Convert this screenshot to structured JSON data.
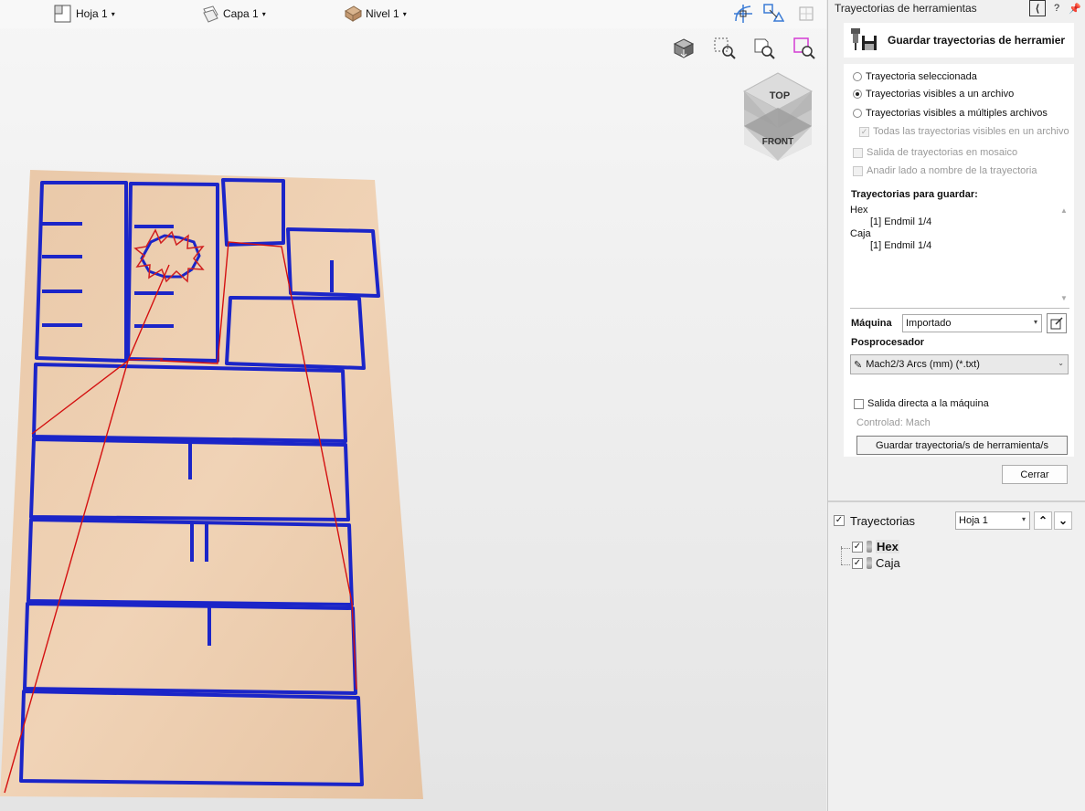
{
  "toolbar": {
    "sheet": "Hoja 1",
    "layer": "Capa 1",
    "level": "Nivel 1"
  },
  "view_cube": {
    "top": "TOP",
    "front": "FRONT"
  },
  "panel": {
    "title": "Trayectorias de herramientas",
    "help": "?",
    "header": "Guardar trayectorias de herramier",
    "radios": [
      {
        "label": "Trayectoria seleccionada",
        "selected": false
      },
      {
        "label": "Trayectorias visibles a un archivo",
        "selected": true
      },
      {
        "label": "Trayectorias visibles a múltiples archivos",
        "selected": false
      }
    ],
    "all_visible": "Todas las trayectorias visibles en un archivo",
    "tile_output": "Salida de trayectorias en mosaico",
    "append_side": "Anadir lado a nombre de la trayectoria",
    "to_save_label": "Trayectorias para guardar:",
    "to_save": [
      {
        "name": "Hex",
        "tool": "[1] Endmil 1/4"
      },
      {
        "name": "Caja",
        "tool": "[1] Endmil 1/4"
      }
    ],
    "machine_label": "Máquina",
    "machine_value": "Importado",
    "postproc_label": "Posprocesador",
    "postproc_value": "Mach2/3 Arcs (mm) (*.txt)",
    "direct_output": "Salida directa a la máquina",
    "controlled": "Controlad:  Mach",
    "save_button": "Guardar trayectoria/s de herramienta/s",
    "close_button": "Cerrar"
  },
  "tree": {
    "title": "Trayectorias",
    "sheet": "Hoja 1",
    "items": [
      "Hex",
      "Caja"
    ]
  }
}
